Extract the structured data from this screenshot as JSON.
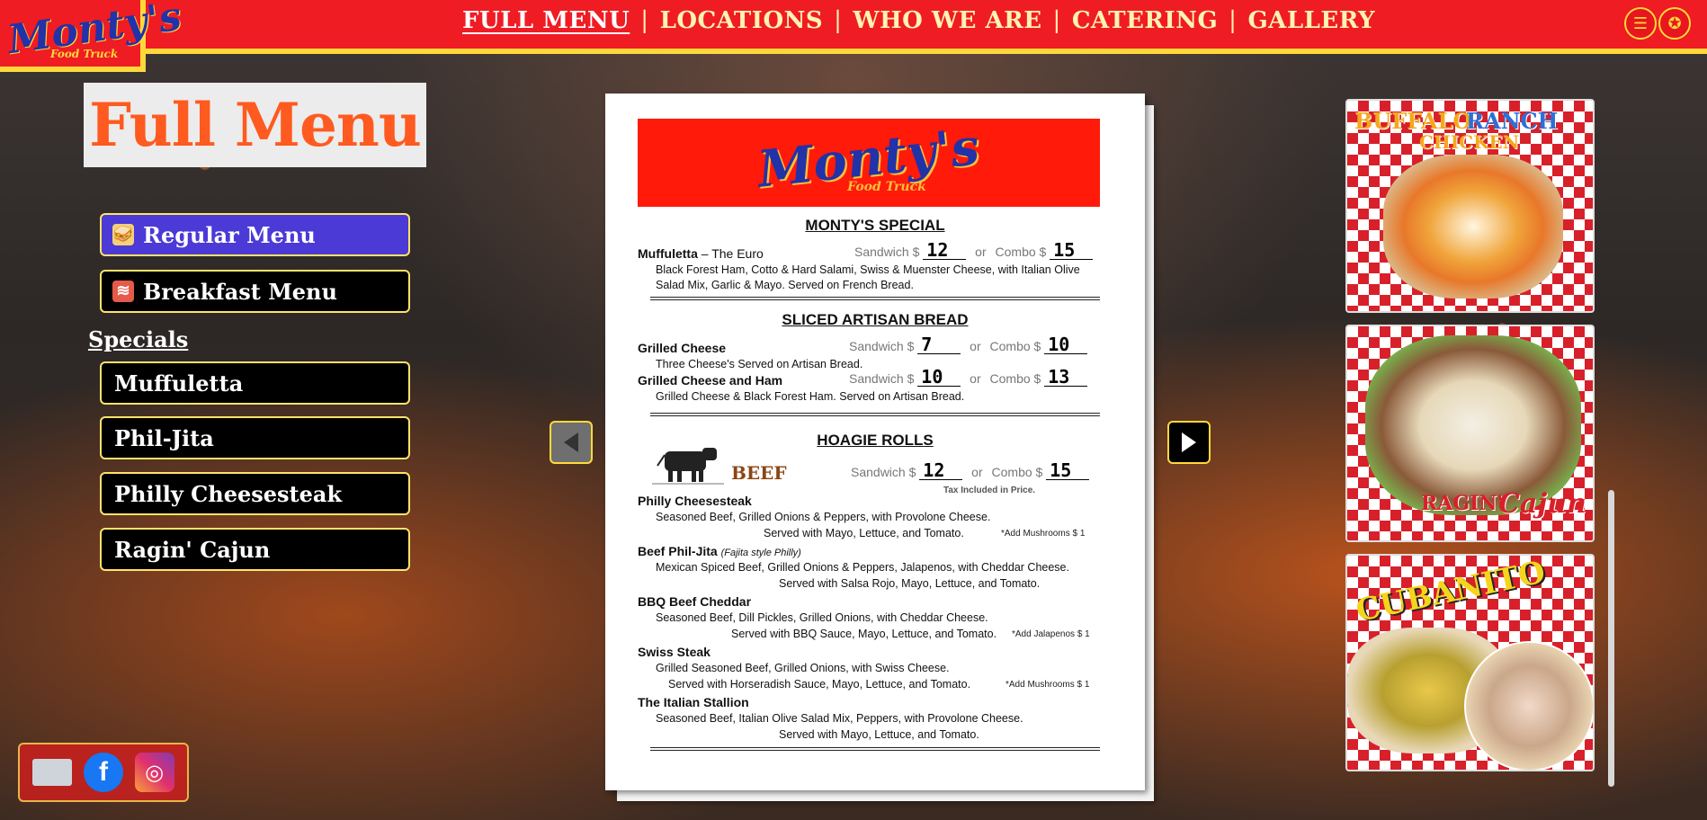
{
  "brand": {
    "logo_text": "Monty's",
    "logo_sub": "Food Truck"
  },
  "nav": {
    "items": [
      "FULL MENU",
      "LOCATIONS",
      "WHO WE ARE",
      "CATERING",
      "GALLERY"
    ],
    "active": "FULL MENU",
    "icons": [
      "burger-icon",
      "badge-icon"
    ]
  },
  "sidebar": {
    "title": "Full Menu",
    "menus": [
      {
        "label": "Regular Menu",
        "icon": "sandwich-icon",
        "active": true
      },
      {
        "label": "Breakfast Menu",
        "icon": "bacon-icon",
        "active": false
      }
    ],
    "specials_label": "Specials",
    "specials": [
      "Muffuletta",
      "Phil-Jita",
      "Philly Cheesesteak",
      "Ragin' Cajun"
    ]
  },
  "social": [
    "email-icon",
    "facebook-icon",
    "instagram-icon"
  ],
  "menu_page": {
    "banner_logo": "Monty's",
    "banner_sub": "Food Truck",
    "sandwich_label": "Sandwich $",
    "or_label": "or",
    "combo_label": "Combo $",
    "sections": {
      "special": {
        "title": "MONTY'S SPECIAL",
        "item_name": "Muffuletta",
        "item_suffix": " – The Euro",
        "sandwich_price": "12",
        "combo_price": "15",
        "desc1": "Black Forest Ham, Cotto & Hard Salami, Swiss & Muenster Cheese, with Italian Olive",
        "desc2": "Salad Mix, Garlic & Mayo. Served on French Bread."
      },
      "artisan": {
        "title": "SLICED ARTISAN BREAD",
        "items": [
          {
            "name": "Grilled Cheese",
            "sandwich_price": "7",
            "combo_price": "10",
            "desc": "Three Cheese's Served on Artisan Bread."
          },
          {
            "name": "Grilled Cheese and Ham",
            "sandwich_price": "10",
            "combo_price": "13",
            "desc": "Grilled Cheese & Black Forest Ham. Served on Artisan Bread."
          }
        ]
      },
      "hoagie": {
        "title": "HOAGIE ROLLS",
        "beef_label": "BEEF",
        "sandwich_price": "12",
        "combo_price": "15",
        "tax_note": "Tax Included in Price.",
        "items": [
          {
            "name": "Philly Cheesesteak",
            "note": "",
            "desc1": "Seasoned Beef, Grilled Onions & Peppers, with Provolone Cheese.",
            "desc2": "Served with Mayo, Lettuce, and Tomato.",
            "addon": "*Add Mushrooms $ 1"
          },
          {
            "name": "Beef Phil-Jita",
            "note": "(Fajita style Philly)",
            "desc1": "Mexican Spiced Beef, Grilled Onions & Peppers, Jalapenos, with Cheddar Cheese.",
            "desc2": "Served with Salsa Rojo, Mayo, Lettuce, and Tomato.",
            "addon": ""
          },
          {
            "name": "BBQ Beef Cheddar",
            "note": "",
            "desc1": "Seasoned Beef, Dill Pickles, Grilled Onions, with Cheddar Cheese.",
            "desc2": "Served with BBQ Sauce, Mayo, Lettuce, and Tomato.",
            "addon": "*Add Jalapenos $ 1"
          },
          {
            "name": "Swiss Steak",
            "note": "",
            "desc1": "Grilled Seasoned Beef, Grilled Onions, with Swiss Cheese.",
            "desc2": "Served with Horseradish Sauce, Mayo, Lettuce, and Tomato.",
            "addon": "*Add Mushrooms $ 1"
          },
          {
            "name": "The Italian Stallion",
            "note": "",
            "desc1": "Seasoned Beef, Italian Olive Salad Mix, Peppers, with Provolone Cheese.",
            "desc2": "Served with Mayo, Lettuce, and Tomato.",
            "addon": ""
          }
        ]
      }
    }
  },
  "gallery": [
    {
      "caption1": "BUFFALO",
      "caption2": "RANCH",
      "caption3": "CHICKEN"
    },
    {
      "caption1": "RAGIN'",
      "caption2": "Cajun"
    },
    {
      "caption1": "CUBANITO"
    }
  ],
  "colors": {
    "brand_red": "#ef1c24",
    "brand_yellow": "#ffd93a",
    "brand_blue": "#2232a8",
    "title_orange": "#ff5a1f",
    "active_button": "#4b3ad6"
  }
}
